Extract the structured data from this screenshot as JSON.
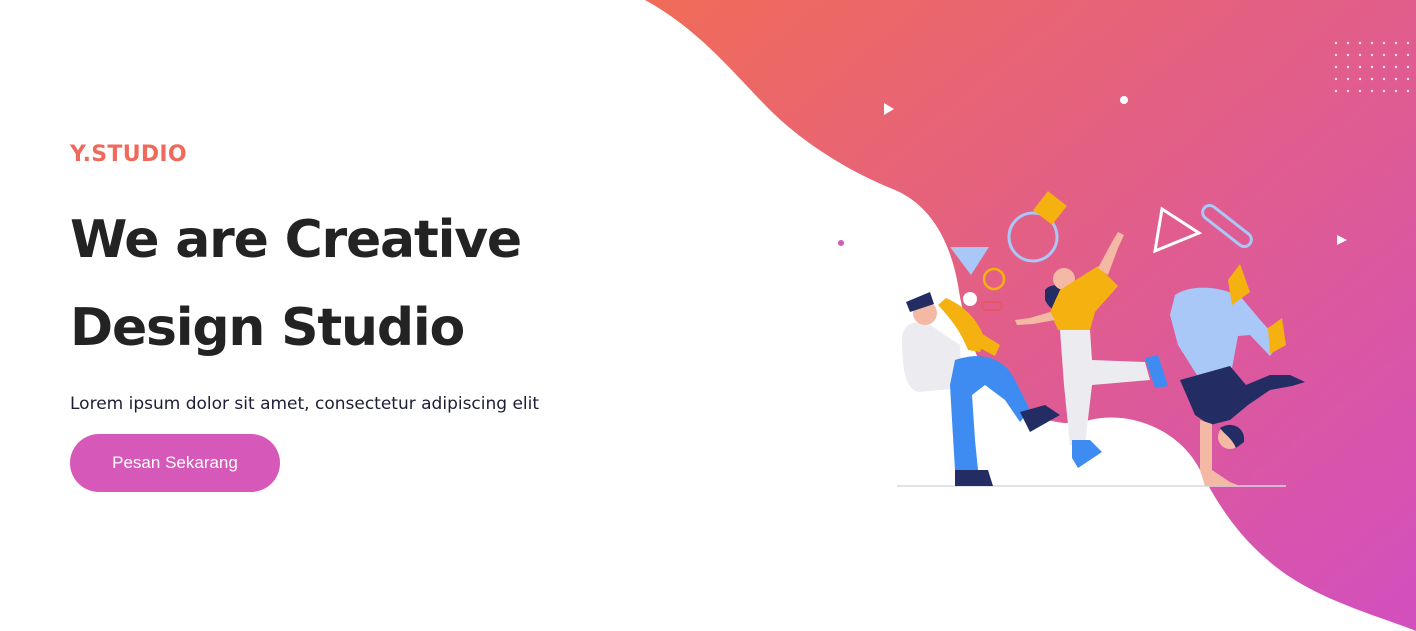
{
  "hero": {
    "brand": "Y.STUDIO",
    "headline_line1": "We are Creative",
    "headline_line2": "Design Studio",
    "subtitle": "Lorem ipsum dolor sit amet, consectetur adipiscing elit",
    "cta_label": "Pesan Sekarang"
  },
  "illustration": {
    "name": "dancing-people-illustration",
    "decor_icons": [
      "play-triangle-icon",
      "dot-icon",
      "circle-ring-icon",
      "square-shape-icon",
      "outline-triangle-icon",
      "pill-shape-icon",
      "dot-grid-pattern"
    ]
  },
  "colors": {
    "brand": "#f06a5c",
    "headline": "#232323",
    "subtitle": "#1d1d36",
    "button": "#d658b8",
    "gradient_start": "#f06c58",
    "gradient_end": "#d24fbf",
    "figure_yellow": "#f4b10f",
    "figure_blue": "#3e8cf2",
    "figure_lightblue": "#a9c7f7",
    "figure_navy": "#232d63"
  }
}
